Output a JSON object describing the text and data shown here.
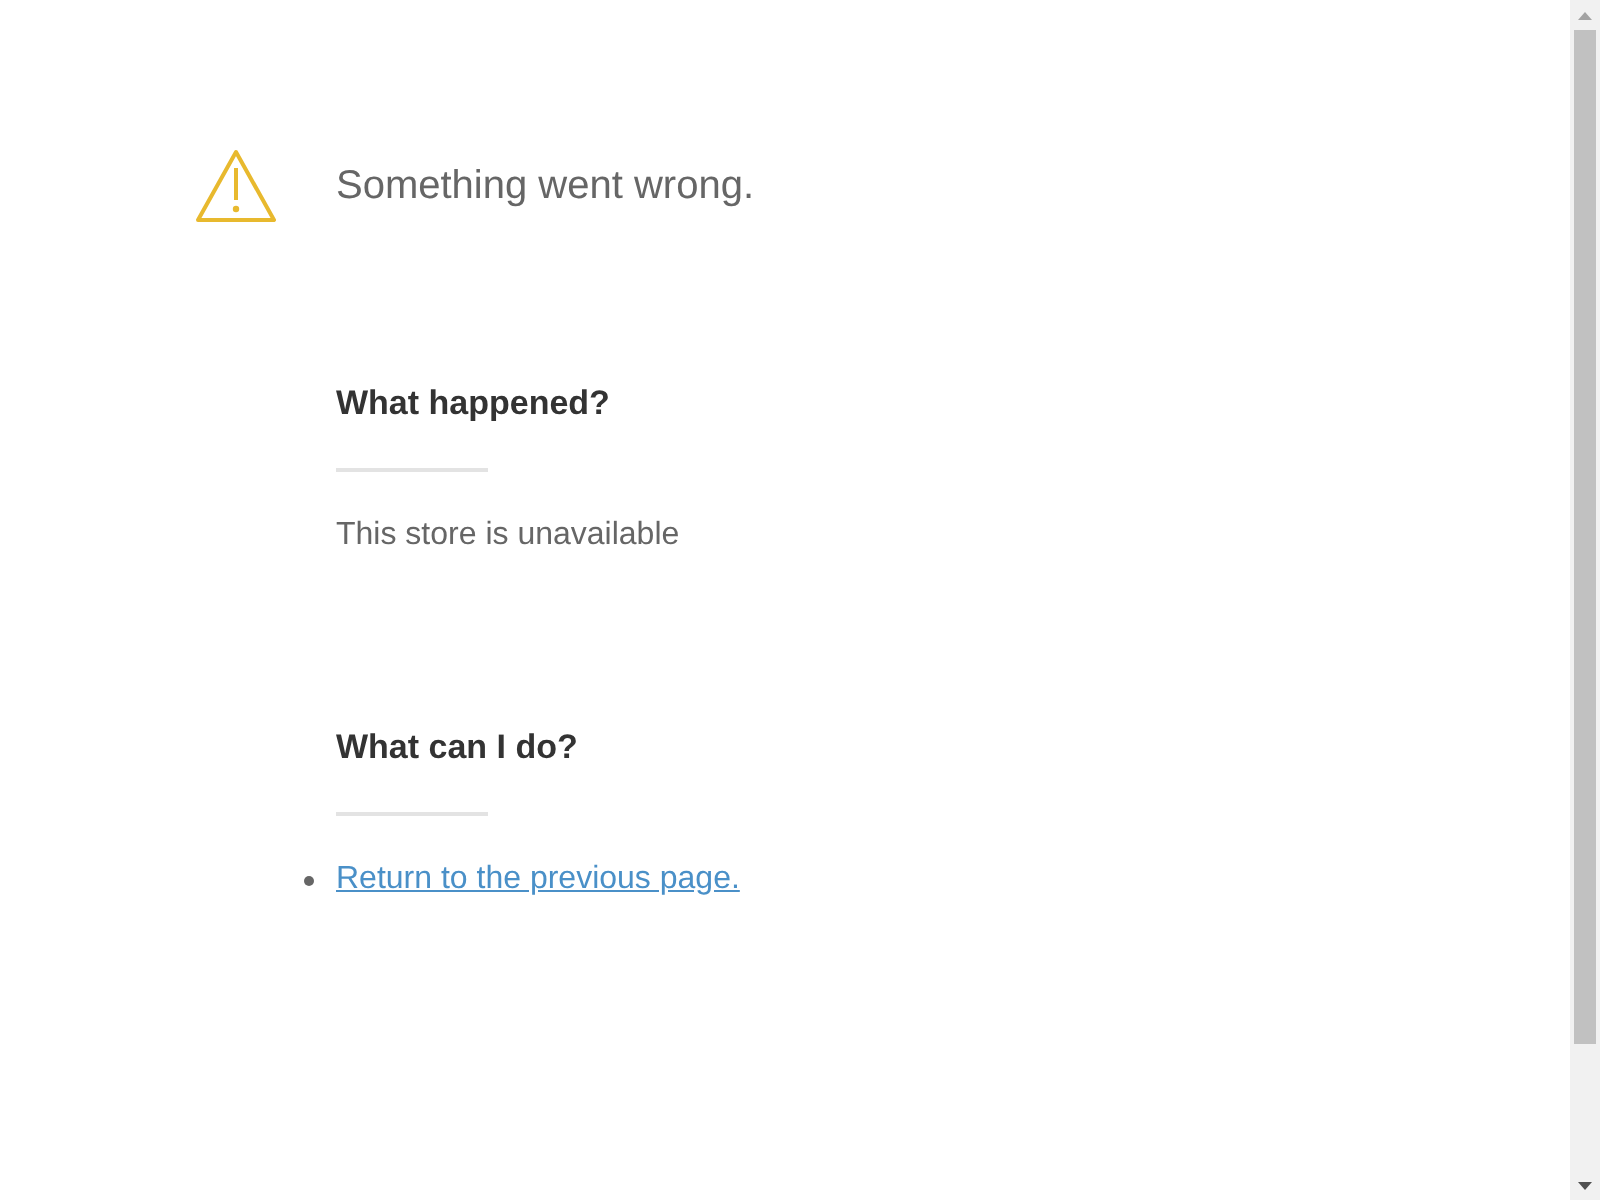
{
  "title": "Something went wrong.",
  "sections": [
    {
      "heading": "What happened?",
      "kind": "text",
      "text": "This store is unavailable"
    },
    {
      "heading": "What can I do?",
      "kind": "links",
      "items": [
        "Return to the previous page."
      ]
    }
  ]
}
